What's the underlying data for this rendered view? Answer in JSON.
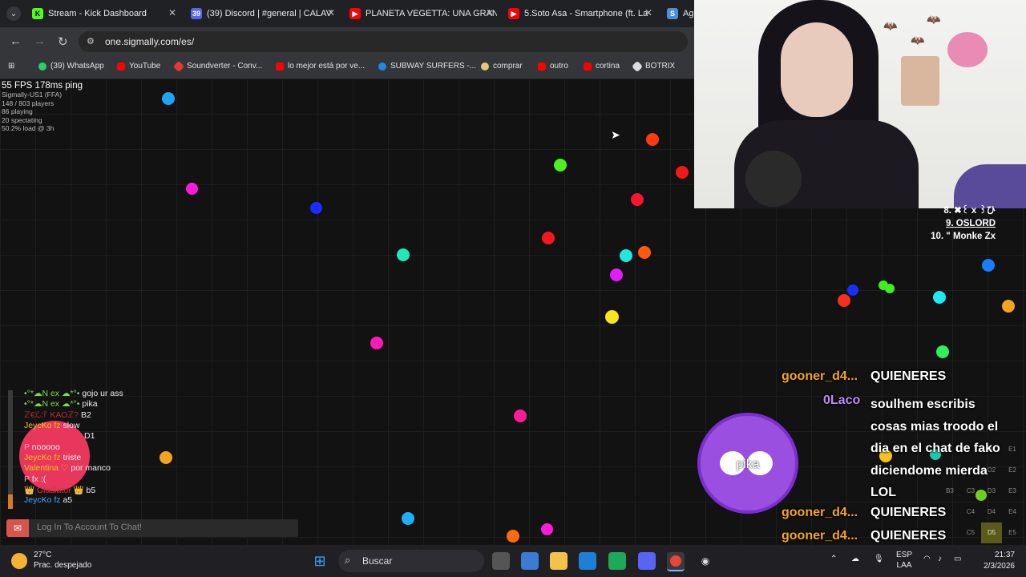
{
  "browser": {
    "tabs": [
      {
        "title": "Stream - Kick Dashboard",
        "icon": "kick-icon",
        "color": "#53fc18"
      },
      {
        "title": "(39) Discord | #general | CALAV",
        "icon": "discord-icon",
        "color": "#5865f2"
      },
      {
        "title": "PLANETA VEGETTA: UNA GRAN",
        "icon": "youtube-icon",
        "color": "#ff0000"
      },
      {
        "title": "5.Soto Asa - Smartphone (ft. La",
        "icon": "youtube-icon",
        "color": "#ff0000"
      },
      {
        "title": "Ag",
        "icon": "sigmally-icon",
        "color": "#4a90d9"
      }
    ],
    "url": "one.sigmally.com/es/",
    "bookmarks": [
      {
        "label": "(39) WhatsApp",
        "color": "#25d366"
      },
      {
        "label": "YouTube",
        "color": "#ff0000"
      },
      {
        "label": "Soundverter - Conv...",
        "color": "#e53935"
      },
      {
        "label": "lo mejor está por ve...",
        "color": "#ff0000"
      },
      {
        "label": "SUBWAY SURFERS -...",
        "color": "#1e88e5"
      },
      {
        "label": "comprar",
        "color": "#e0c87a"
      },
      {
        "label": "outro",
        "color": "#ff0000"
      },
      {
        "label": "cortina",
        "color": "#ff0000"
      },
      {
        "label": "BOTRIX",
        "color": "#dddddd"
      }
    ]
  },
  "game": {
    "fps_line": "55 FPS 178ms ping",
    "server": "Sigmally-US1 (FFA)",
    "players": "148 / 803 players",
    "playing": "86 playing",
    "spectating": "20 spectating",
    "load": "50.2% load @ 3h",
    "leaderboard": [
      {
        "text": "8. ✖꒰ x ꒱ひ"
      },
      {
        "text": "9. OSLORD"
      },
      {
        "text": "10. \" Monke Zx"
      }
    ],
    "player_cell_label": "pika"
  },
  "game_chat": {
    "lines": [
      {
        "name": "•°*☁N ex ☁*°•",
        "msg": "gojo ur ass",
        "color": "#7ed957"
      },
      {
        "name": "•°*☁N ex ☁*°•",
        "msg": "pika",
        "color": "#7ed957"
      },
      {
        "name": "ℤ€ℒℱ ΚΑΟℤ?",
        "msg": "B2",
        "color": "#b03030"
      },
      {
        "name": "JeycKo fz",
        "msg": "slow",
        "color": "#f5c518"
      },
      {
        "name": "",
        "msg": "D1",
        "color": "#ffffff"
      },
      {
        "name": "P",
        "msg": "nooooo",
        "color": "#ff5a9e"
      },
      {
        "name": "JeycKo fz",
        "msg": "triste",
        "color": "#f5c518"
      },
      {
        "name": "Valentina ♡",
        "msg": "por manco",
        "color": "#f5c518"
      },
      {
        "name": "P",
        "msg": "fx :(",
        "color": "#ff5a9e"
      },
      {
        "name": "👑 Gladiator 👑",
        "msg": "b5",
        "color": "#c23b3b"
      },
      {
        "name": "JeycKo fz",
        "msg": "a5",
        "color": "#4aa3ff"
      }
    ],
    "input_placeholder": "Log In To Account To Chat!"
  },
  "stream_chat": [
    {
      "user": "gooner_d4...",
      "msg": "QUIENERES",
      "kind": "user"
    },
    {
      "user": "0Laco",
      "msg": "soulhem escribis cosas mias troodo el dia en el chat de fako diciendome mierda LOL",
      "kind": "user2"
    },
    {
      "user": "gooner_d4...",
      "msg": "QUIENERES",
      "kind": "user"
    },
    {
      "user": "gooner_d4...",
      "msg": "QUIENERES",
      "kind": "user"
    }
  ],
  "minimap": {
    "cells": [
      "D1",
      "E1",
      "D2",
      "E2",
      "B3",
      "C3",
      "D3",
      "E3",
      "C4",
      "D4",
      "E4",
      "C5",
      "D5",
      "E5"
    ]
  },
  "taskbar": {
    "temp": "27°C",
    "weather": "Prac. despejado",
    "search_label": "Buscar",
    "lang_top": "ESP",
    "lang_bottom": "LAA",
    "time": "21:37",
    "date": "2/3/2026"
  }
}
